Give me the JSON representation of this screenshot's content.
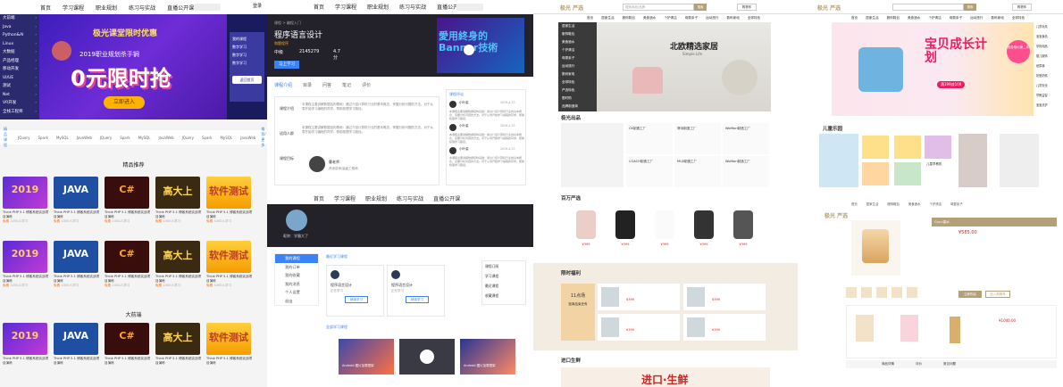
{
  "panel1": {
    "nav": [
      "首页",
      "学习课程",
      "职业规划",
      "练习与实战",
      "直播公开课"
    ],
    "sidebar": [
      "大前端",
      "Java",
      "Python&AI",
      "Linux",
      "大数据",
      "产品经理",
      "移动开发",
      "UI/UE",
      "测试",
      "Net",
      "VR开发",
      "全栈工程师"
    ],
    "banner": {
      "title": "极光课堂限时优惠",
      "year": "2019职业规划杀手锏",
      "big": "0元限时抢",
      "cta": "立即进入"
    },
    "login": {
      "title": "我的课程",
      "items": [
        "数字学习",
        "数字学习",
        "数字学习"
      ],
      "more": "返回首页"
    },
    "tag_label": "精品课程",
    "tags": [
      "JQuery",
      "Spark",
      "MySQL",
      "JavaWeb",
      "JQuery",
      "Spark",
      "MySQL",
      "JavaWeb",
      "JQuery",
      "Spark",
      "MySQL",
      "JavaWeb"
    ],
    "tag_more": "推荐/更多",
    "section1": "精品推荐",
    "section2": "大前端",
    "cards": [
      {
        "cap": "Think PHP 5.1 博客系统实战项目演练",
        "price": "免费",
        "count": "1000人学习",
        "art": "2019"
      },
      {
        "cap": "Think PHP 5.1 博客系统实战项目演练",
        "price": "免费",
        "count": "1000人学习",
        "art": "JAVA"
      },
      {
        "cap": "Think PHP 5.1 博客系统实战项目演练",
        "price": "免费",
        "count": "1000人学习",
        "art": "C#"
      },
      {
        "cap": "Think PHP 5.1 博客系统实战项目演练",
        "price": "免费",
        "count": "1000人学习",
        "art": "高大上"
      },
      {
        "cap": "Think PHP 5.1 博客系统实战项目演练",
        "price": "免费",
        "count": "1000人学习",
        "art": "软件测试"
      }
    ]
  },
  "panel2": {
    "nav": [
      "首页",
      "学习课程",
      "职业规划",
      "练习与实战",
      "直播公开课"
    ],
    "breadcrumb": "课程 > 编程入门",
    "course_title": "程序语言设计",
    "badge": "和题程序",
    "difficulty": "中级",
    "students": "2145279",
    "rating": "4.7分",
    "join": "马上学习",
    "video_text": "愛用終身的 Banner技術",
    "tabs": [
      "课程介绍",
      "目录",
      "问答",
      "笔记",
      "评价"
    ],
    "rows": [
      "课程介绍",
      "适用人群",
      "课程目标"
    ],
    "desc": "本课程主要讲解数据结构基础：通过介绍计算机行业的基本概念，掌握分析问题的方法。对于从零开始学习编程的同学，帮助梳理学习路径。",
    "reviews_title": "课程评论",
    "reviewer": "小叶姿",
    "date": "2019-4-23",
    "teacher": "曹老师",
    "teacher_title": "资深讲师/高级工程师",
    "nav_lower": [
      "首页",
      "学习课程",
      "职业规划",
      "练习与实战",
      "直播公开课"
    ],
    "profile_name": "昵称：学霸大了",
    "side_items": [
      "我的课程",
      "我的订单",
      "我的收藏",
      "我的消息",
      "个人设置",
      "退出"
    ],
    "recent": "最近学习课程",
    "course_card": "程序语言设计",
    "course_meta": "正在学习",
    "cont_btn": "继续学习",
    "right_tabs": [
      "课程订阅",
      "学习课程",
      "最近课程",
      "收藏课程"
    ],
    "collect": "全部学习课程",
    "video_cap1": "Android 图片加载框架",
    "video_cap2": "Android 图片加载框架"
  },
  "panel3": {
    "logo": "极光 严选",
    "search_placeholder": "搜索商品/品牌",
    "search_btn": "搜索",
    "cart": "购物车",
    "nav": [
      "首页",
      "居家生活",
      "服饰鞋包",
      "美食酒水",
      "个护清洁",
      "母婴亲子",
      "运动旅行",
      "数码家电",
      "全球特色"
    ],
    "cats": [
      "居家生活",
      "服饰鞋包",
      "美食酒水",
      "个护清洁",
      "母婴亲子",
      "运动旅行",
      "数码家电",
      "全球特色",
      "严选特色",
      "限时购",
      "品牌制造商"
    ],
    "banner_title": "北欧精选家居",
    "banner_sub": "Simple Life",
    "sec1": "极光出品",
    "sec2": "百万严选",
    "sec3": "限时福利",
    "sec4": "进口生鲜",
    "sale_text": "11点场",
    "sale_sub": "距离结束还有",
    "fresh": "进口·生鲜",
    "factories": [
      "CK制造工厂",
      "菲诗制造工厂",
      "Wolfton制造工厂",
      "COACH制造工厂",
      "MUJI制造工厂"
    ],
    "price": "¥399"
  },
  "panel4": {
    "logo": "极光 严选",
    "search_btn": "搜索",
    "cart": "购物车",
    "nav": [
      "首页",
      "居家生活",
      "服饰鞋包",
      "美食酒水",
      "个护清洁",
      "母婴亲子",
      "运动旅行",
      "数码家电",
      "全球特色"
    ],
    "banner_title": "宝贝成长计划",
    "banner_sub": "满199减100",
    "badge": "优惠限时第二件",
    "side_links": [
      "儿童玩具",
      "宝宝食品",
      "孕妈用品",
      "婴儿服饰",
      "纸尿裤",
      "奶瓶奶嘴",
      "儿童安全",
      "早教益智",
      "宝宝洗护"
    ],
    "sec": "儿童乐园",
    "toy_label": "儿童早教机",
    "logo2": "极光 严选",
    "product_tag": "Gucci香水",
    "product_price": "¥585.00",
    "buy_btn": "立即购买",
    "cart_btn": "加入购物车",
    "rec_price": "¥1040.00",
    "tabs": [
      "商品详情",
      "评价",
      "常见问题"
    ],
    "colors": {
      "accent": "#b4a078",
      "pink": "#e91e63"
    }
  },
  "colors": {
    "purple": "#2b2a6f",
    "brand_orange": "#f60",
    "blue": "#3b82f6",
    "dark": "#232229",
    "gold": "#b4a078"
  }
}
